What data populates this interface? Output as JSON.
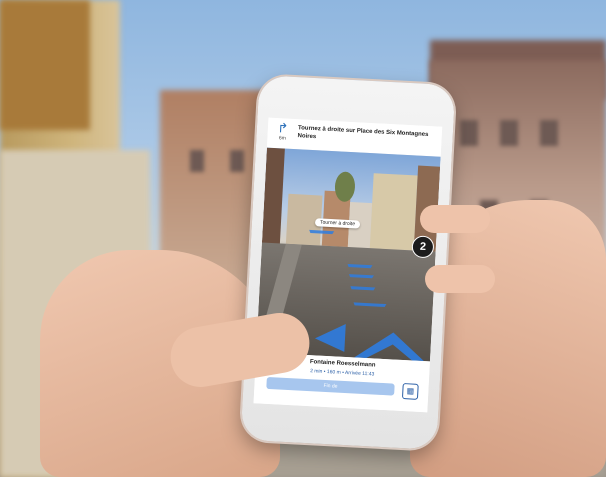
{
  "navigation": {
    "turn_icon": "turn-right-arrow-icon",
    "turn_distance": "6m",
    "instruction": "Tournez à droite sur Place des Six Montagnes Noires"
  },
  "ar_view": {
    "turn_label": "Tourner à droite",
    "distance_badge": "2",
    "arrow_color": "#2e7ce0"
  },
  "destination": {
    "name": "Fontaine Roesselmann",
    "trip_meta": "2 min • 160 m • Arrivée 11:43",
    "stop_label": "Fin de",
    "map_toggle_icon": "map-icon"
  },
  "colors": {
    "accent": "#2b5fa6",
    "button": "#a7c6ee"
  }
}
